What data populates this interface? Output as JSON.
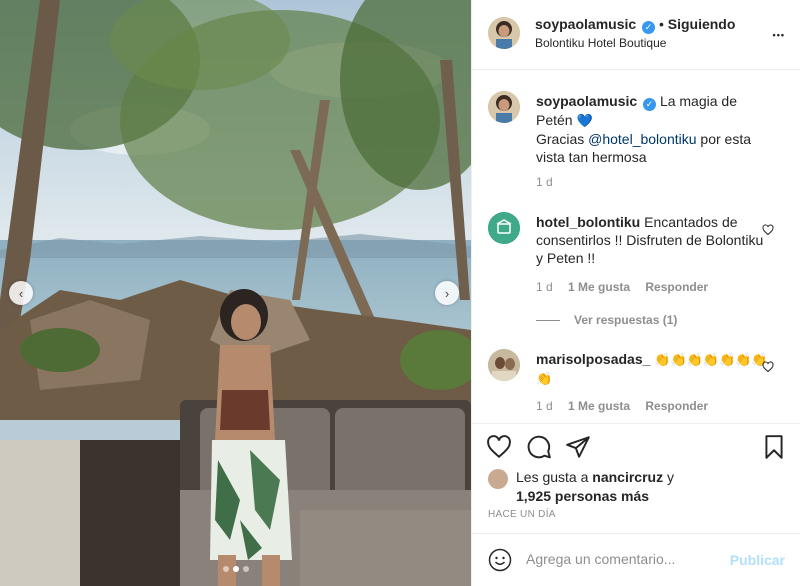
{
  "post": {
    "header": {
      "username": "soypaolamusic",
      "separator": "•",
      "follow_state": "Siguiendo",
      "location": "Bolontiku Hotel Boutique",
      "more": "•••"
    },
    "caption": {
      "username": "soypaolamusic",
      "text_1": "La magia de Petén",
      "emoji": "💙",
      "text_2a": "Gracias",
      "mention": "@hotel_bolontiku",
      "text_2b": "por esta vista tan hermosa",
      "time": "1 d"
    },
    "comments": [
      {
        "username": "hotel_bolontiku",
        "text": "Encantados de consentirlos !! Disfruten de Bolontiku y Peten !!",
        "time": "1 d",
        "likes": "1 Me gusta",
        "reply": "Responder",
        "view_replies": "Ver respuestas (1)"
      },
      {
        "username": "marisolposadas_",
        "text": "👏👏👏👏👏👏👏👏",
        "time": "1 d",
        "likes": "1 Me gusta",
        "reply": "Responder"
      }
    ],
    "likes_line": {
      "prefix": "Les gusta a",
      "user": "nancircruz",
      "mid": "y",
      "count": "1,925 personas más"
    },
    "time_ago": "HACE UN DÍA",
    "add_comment": {
      "placeholder": "Agrega un comentario...",
      "publish": "Publicar"
    },
    "carousel": {
      "total": 3,
      "active_index": 2
    },
    "icons": {
      "like": "heart-icon",
      "comment": "comment-icon",
      "share": "paper-plane-icon",
      "save": "bookmark-icon",
      "emoji": "smiley-icon",
      "prev": "chevron-left-icon",
      "next": "chevron-right-icon"
    },
    "colors": {
      "link": "#00376b",
      "verified": "#3897f0",
      "muted": "#8e8e8e",
      "publish_disabled": "#b2dffc"
    }
  }
}
